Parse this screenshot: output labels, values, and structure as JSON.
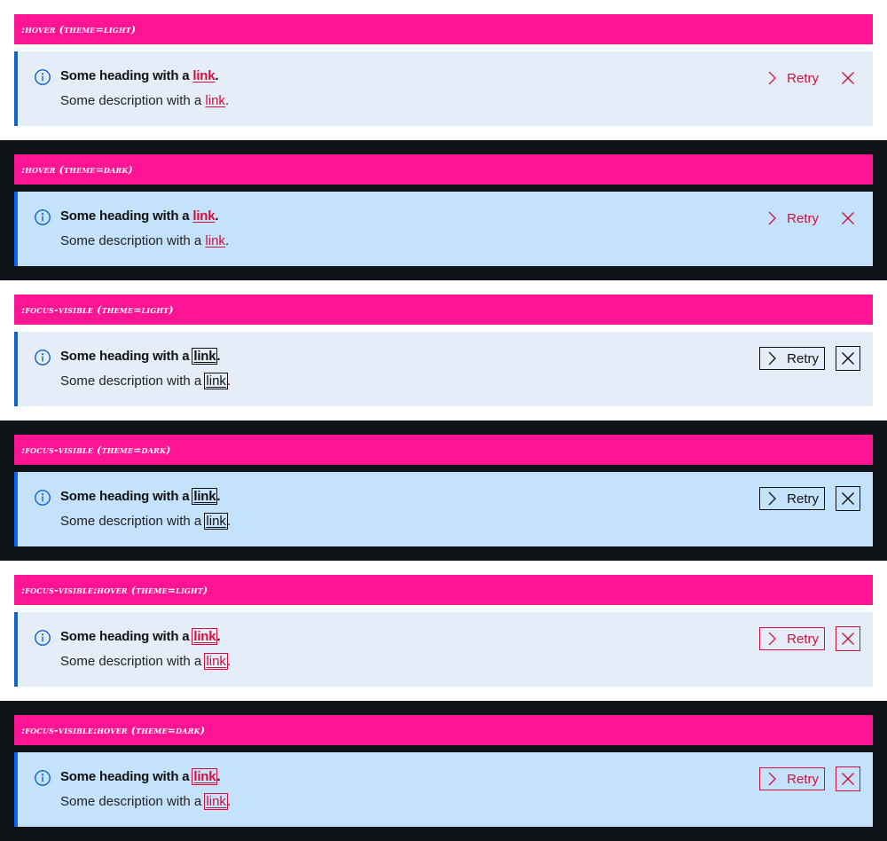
{
  "colors": {
    "label_bar": "#ff1493",
    "light_bg": "#ffffff",
    "dark_bg": "#101418",
    "notif_light_bg": "#e5eef8",
    "notif_dark_bg": "#c4e2fc",
    "accent_border": "#0f62fe",
    "link_red": "#d0103a",
    "focus_outline": "#111111"
  },
  "sections": [
    {
      "label": ":hover (theme=light)",
      "theme": "light",
      "mode": "hover",
      "heading_prefix": "Some heading with a ",
      "heading_link": "link",
      "heading_suffix": ".",
      "desc_prefix": "Some description with a ",
      "desc_link": "link",
      "desc_suffix": ".",
      "action_label": "Retry",
      "icons": [
        "info-icon",
        "chevron-right-icon",
        "close-icon"
      ]
    },
    {
      "label": ":hover (theme=dark)",
      "theme": "dark",
      "mode": "hover",
      "heading_prefix": "Some heading with a ",
      "heading_link": "link",
      "heading_suffix": ".",
      "desc_prefix": "Some description with a ",
      "desc_link": "link",
      "desc_suffix": ".",
      "action_label": "Retry",
      "icons": [
        "info-icon",
        "chevron-right-icon",
        "close-icon"
      ]
    },
    {
      "label": ":focus-visible (theme=light)",
      "theme": "light",
      "mode": "focus",
      "heading_prefix": "Some heading with a ",
      "heading_link": "link",
      "heading_suffix": ".",
      "desc_prefix": "Some description with a ",
      "desc_link": "link",
      "desc_suffix": ".",
      "action_label": "Retry",
      "icons": [
        "info-icon",
        "chevron-right-icon",
        "close-icon"
      ]
    },
    {
      "label": ":focus-visible (theme=dark)",
      "theme": "dark",
      "mode": "focus",
      "heading_prefix": "Some heading with a ",
      "heading_link": "link",
      "heading_suffix": ".",
      "desc_prefix": "Some description with a ",
      "desc_link": "link",
      "desc_suffix": ".",
      "action_label": "Retry",
      "icons": [
        "info-icon",
        "chevron-right-icon",
        "close-icon"
      ]
    },
    {
      "label": ":focus-visible:hover (theme=light)",
      "theme": "light",
      "mode": "focus-hover",
      "heading_prefix": "Some heading with a ",
      "heading_link": "link",
      "heading_suffix": ".",
      "desc_prefix": "Some description with a ",
      "desc_link": "link",
      "desc_suffix": ".",
      "action_label": "Retry",
      "icons": [
        "info-icon",
        "chevron-right-icon",
        "close-icon"
      ]
    },
    {
      "label": ":focus-visible:hover (theme=dark)",
      "theme": "dark",
      "mode": "focus-hover",
      "heading_prefix": "Some heading with a ",
      "heading_link": "link",
      "heading_suffix": ".",
      "desc_prefix": "Some description with a ",
      "desc_link": "link",
      "desc_suffix": ".",
      "action_label": "Retry",
      "icons": [
        "info-icon",
        "chevron-right-icon",
        "close-icon"
      ]
    }
  ]
}
